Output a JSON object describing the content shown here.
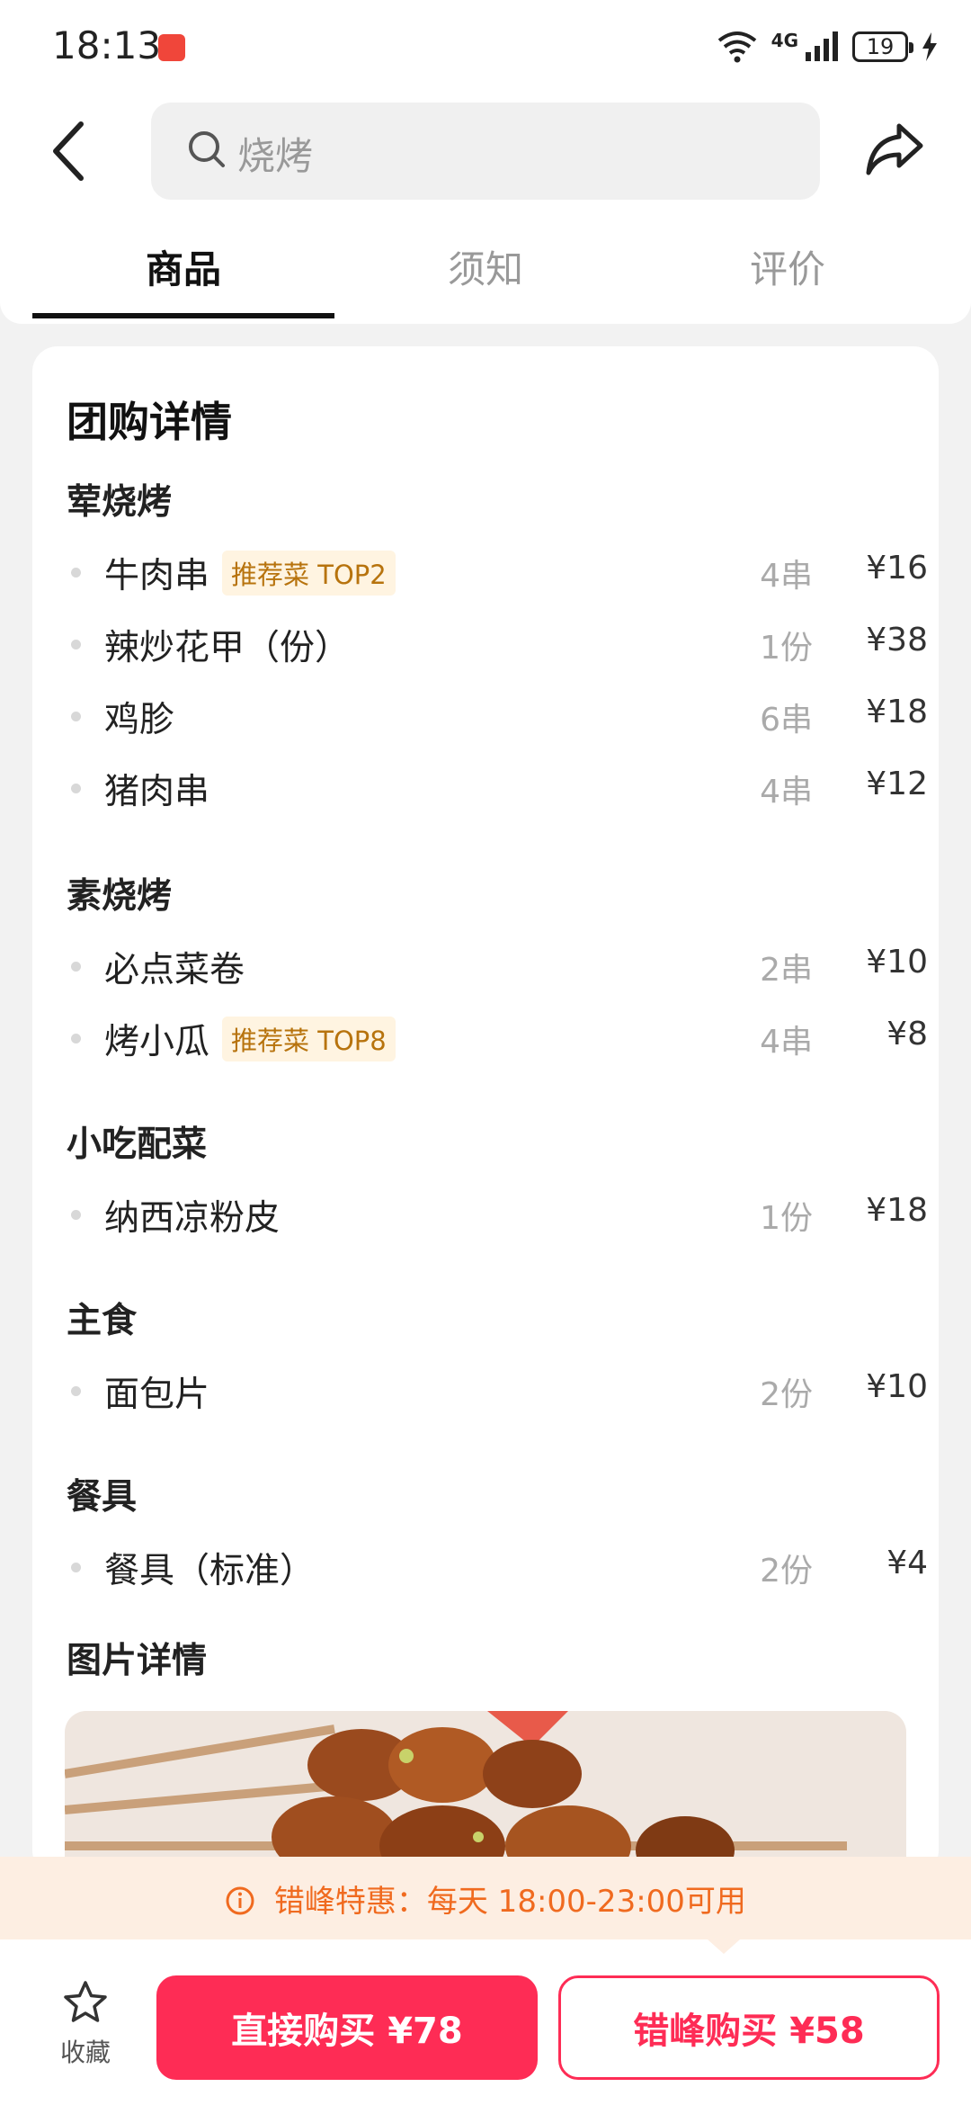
{
  "status": {
    "time": "18:13",
    "network": "4G",
    "battery": "19"
  },
  "search": {
    "text": "烧烤"
  },
  "tabs": [
    {
      "label": "商品",
      "active": true
    },
    {
      "label": "须知",
      "active": false
    },
    {
      "label": "评价",
      "active": false
    }
  ],
  "details": {
    "title": "团购详情",
    "groups": [
      {
        "title": "荤烧烤",
        "items": [
          {
            "name": "牛肉串",
            "tag": "推荐菜 TOP2",
            "qty": "4串",
            "price": "¥16"
          },
          {
            "name": "辣炒花甲（份）",
            "qty": "1份",
            "price": "¥38"
          },
          {
            "name": "鸡胗",
            "qty": "6串",
            "price": "¥18"
          },
          {
            "name": "猪肉串",
            "qty": "4串",
            "price": "¥12"
          }
        ]
      },
      {
        "title": "素烧烤",
        "items": [
          {
            "name": "必点菜卷",
            "qty": "2串",
            "price": "¥10"
          },
          {
            "name": "烤小瓜",
            "tag": "推荐菜 TOP8",
            "qty": "4串",
            "price": "¥8"
          }
        ]
      },
      {
        "title": "小吃配菜",
        "items": [
          {
            "name": "纳西凉粉皮",
            "qty": "1份",
            "price": "¥18"
          }
        ]
      },
      {
        "title": "主食",
        "items": [
          {
            "name": "面包片",
            "qty": "2份",
            "price": "¥10"
          }
        ]
      },
      {
        "title": "餐具",
        "items": [
          {
            "name": "餐具（标准）",
            "qty": "2份",
            "price": "¥4"
          }
        ]
      }
    ],
    "photo_title": "图片详情"
  },
  "banner": {
    "text": "错峰特惠：每天 18:00-23:00可用"
  },
  "bottom": {
    "favorite": "收藏",
    "direct_buy": "直接购买 ¥78",
    "offpeak_buy": "错峰购买 ¥58"
  },
  "colors": {
    "accent": "#fe2c55",
    "banner_text": "#f06a1f",
    "tag_text": "#b7730d"
  }
}
